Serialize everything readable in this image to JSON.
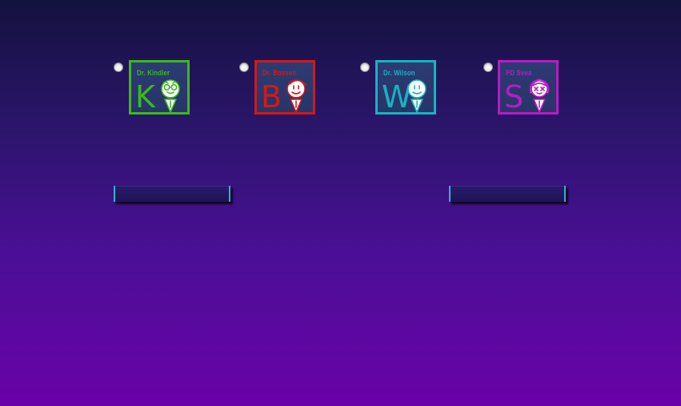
{
  "characters": [
    {
      "name": "Dr. Kindler",
      "letter": "K",
      "color": "#3cb81e",
      "icon": "kindler-avatar-icon",
      "selected": false
    },
    {
      "name": "Dr. Bossen",
      "letter": "B",
      "color": "#d01a1a",
      "icon": "bossen-avatar-icon",
      "selected": false
    },
    {
      "name": "Dr. Wilson",
      "letter": "W",
      "color": "#18b2c0",
      "icon": "wilson-avatar-icon",
      "selected": false
    },
    {
      "name": "PD Svea",
      "letter": "S",
      "color": "#b51cc4",
      "icon": "svea-avatar-icon",
      "selected": false
    }
  ],
  "buttons": {
    "left_label": "",
    "right_label": ""
  },
  "colors": {
    "background_top": "#14123f",
    "background_bottom": "#6a02a8",
    "button_accent": "#2bb6c9"
  }
}
